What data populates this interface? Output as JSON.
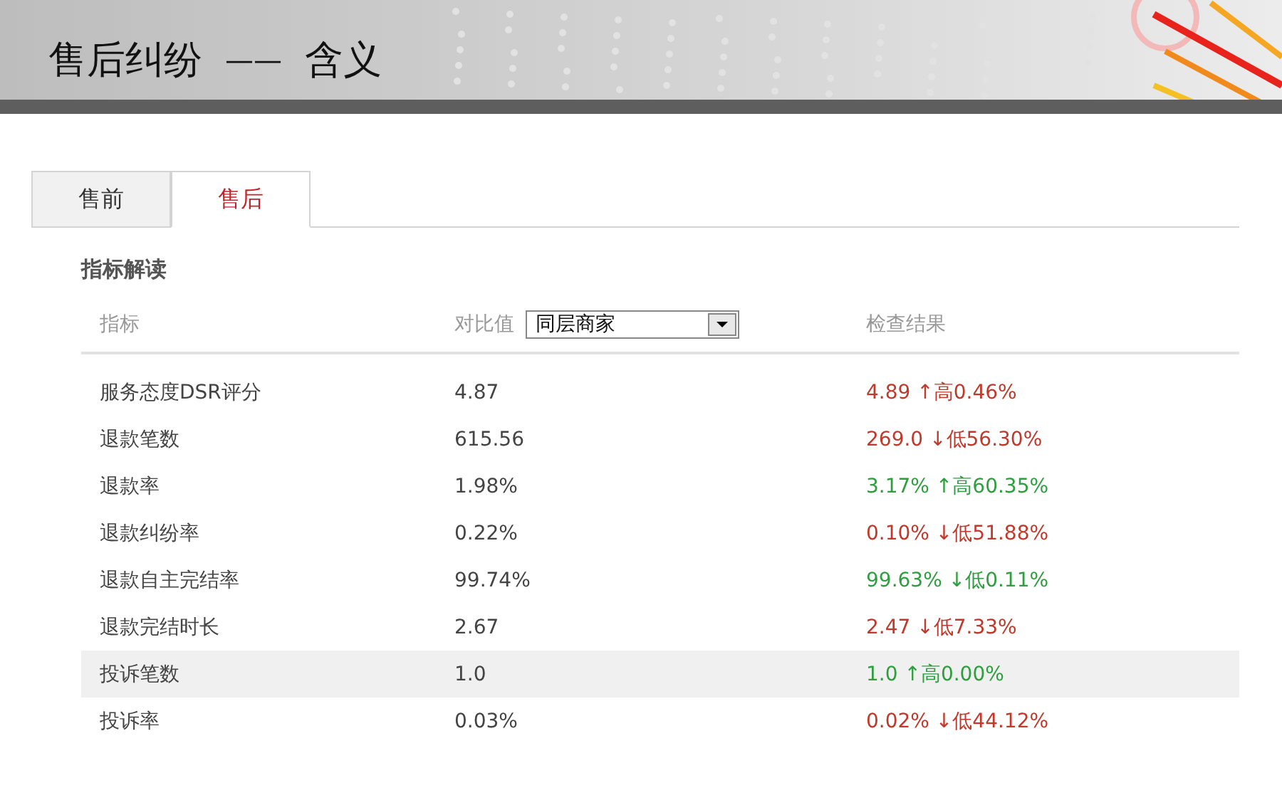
{
  "header": {
    "title": "售后纠纷",
    "separator": "——",
    "subtitle": "含义"
  },
  "tabs": [
    {
      "label": "售前",
      "selected": false
    },
    {
      "label": "售后",
      "selected": true
    }
  ],
  "section_title": "指标解读",
  "table": {
    "columns": [
      {
        "label": "指标"
      },
      {
        "label": "对比值"
      },
      {
        "label": "检查结果"
      }
    ],
    "compare_select": {
      "value": "同层商家"
    },
    "rows": [
      {
        "metric": "服务态度DSR评分",
        "value": "4.87",
        "result": "4.89 ↑高0.46%",
        "color": "#c0392b",
        "highlighted": false
      },
      {
        "metric": "退款笔数",
        "value": "615.56",
        "result": "269.0 ↓低56.30%",
        "color": "#c0392b",
        "highlighted": false
      },
      {
        "metric": "退款率",
        "value": "1.98%",
        "result": "3.17% ↑高60.35%",
        "color": "#2e9e3e",
        "highlighted": false
      },
      {
        "metric": "退款纠纷率",
        "value": "0.22%",
        "result": "0.10% ↓低51.88%",
        "color": "#c0392b",
        "highlighted": false
      },
      {
        "metric": "退款自主完结率",
        "value": "99.74%",
        "result": "99.63% ↓低0.11%",
        "color": "#2e9e3e",
        "highlighted": false
      },
      {
        "metric": "退款完结时长",
        "value": "2.67",
        "result": "2.47 ↓低7.33%",
        "color": "#c0392b",
        "highlighted": false
      },
      {
        "metric": "投诉笔数",
        "value": "1.0",
        "result": "1.0 ↑高0.00%",
        "color": "#2e9e3e",
        "highlighted": true
      },
      {
        "metric": "投诉率",
        "value": "0.03%",
        "result": "0.02% ↓低44.12%",
        "color": "#c0392b",
        "highlighted": false
      }
    ]
  }
}
